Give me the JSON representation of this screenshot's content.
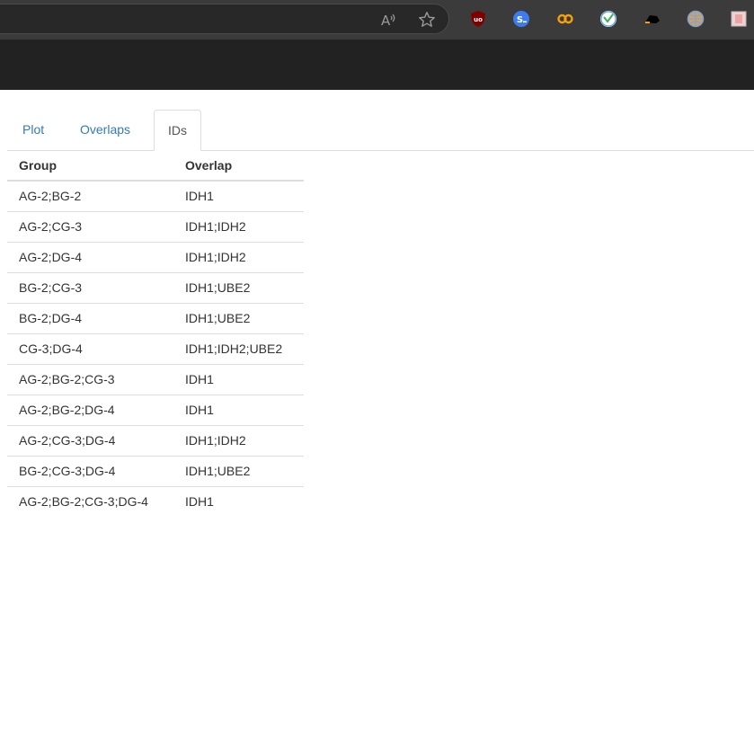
{
  "browser": {
    "read_aloud_glyph": "A",
    "extensions": [
      {
        "name": "ublock-origin-icon",
        "color": "#800000",
        "glyph": "uo"
      },
      {
        "name": "s-extension-icon",
        "color": "#3d7bf0",
        "glyph": "S"
      },
      {
        "name": "infinity-icon",
        "color": "#f5a10b",
        "glyph": "∞"
      },
      {
        "name": "circular-extension-icon",
        "color": "#3fae5c",
        "glyph": "⟳"
      },
      {
        "name": "dark-shape-extension-icon",
        "color": "#000000",
        "glyph": ""
      },
      {
        "name": "globe-extension-icon",
        "color": "#7fa1d6",
        "glyph": ""
      },
      {
        "name": "pink-square-extension-icon",
        "color": "#e9a6a6",
        "glyph": ""
      }
    ]
  },
  "tabs": [
    {
      "label": "Plot",
      "active": false
    },
    {
      "label": "Overlaps",
      "active": false
    },
    {
      "label": "IDs",
      "active": true
    }
  ],
  "table": {
    "headers": {
      "group": "Group",
      "overlap": "Overlap"
    },
    "rows": [
      {
        "group": "AG-2;BG-2",
        "overlap": "IDH1"
      },
      {
        "group": "AG-2;CG-3",
        "overlap": "IDH1;IDH2"
      },
      {
        "group": "AG-2;DG-4",
        "overlap": "IDH1;IDH2"
      },
      {
        "group": "BG-2;CG-3",
        "overlap": "IDH1;UBE2"
      },
      {
        "group": "BG-2;DG-4",
        "overlap": "IDH1;UBE2"
      },
      {
        "group": "CG-3;DG-4",
        "overlap": "IDH1;IDH2;UBE2"
      },
      {
        "group": "AG-2;BG-2;CG-3",
        "overlap": "IDH1"
      },
      {
        "group": "AG-2;BG-2;DG-4",
        "overlap": "IDH1"
      },
      {
        "group": "AG-2;CG-3;DG-4",
        "overlap": "IDH1;IDH2"
      },
      {
        "group": "BG-2;CG-3;DG-4",
        "overlap": "IDH1;UBE2"
      },
      {
        "group": "AG-2;BG-2;CG-3;DG-4",
        "overlap": "IDH1"
      }
    ]
  },
  "colors": {
    "link": "#337ab7",
    "active_tab_text": "#555555",
    "text": "#333333",
    "border": "#dddddd",
    "toolbar_bg": "#3b3b3b",
    "header_band_bg": "#222222"
  }
}
